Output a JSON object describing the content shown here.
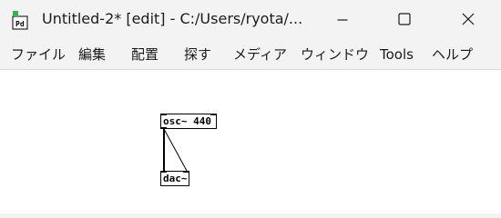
{
  "window": {
    "title": "Untitled-2* [edit] - C:/Users/ryota/...",
    "app_icon": "pd-icon"
  },
  "window_controls": {
    "minimize_icon": "minimize-icon",
    "maximize_icon": "maximize-icon",
    "close_icon": "close-icon"
  },
  "menu": {
    "items": [
      {
        "label": "ファイル"
      },
      {
        "label": "編集"
      },
      {
        "label": "配置"
      },
      {
        "label": "探す"
      },
      {
        "label": "メディア"
      },
      {
        "label": "ウィンドウ"
      },
      {
        "label": "Tools"
      },
      {
        "label": "ヘルプ"
      }
    ]
  },
  "canvas": {
    "objects": [
      {
        "text": "osc~ 440"
      },
      {
        "text": "dac~"
      }
    ]
  },
  "colors": {
    "chrome": "#f3f3f3",
    "canvas": "#ffffff",
    "icon_green": "#2fb84a"
  }
}
